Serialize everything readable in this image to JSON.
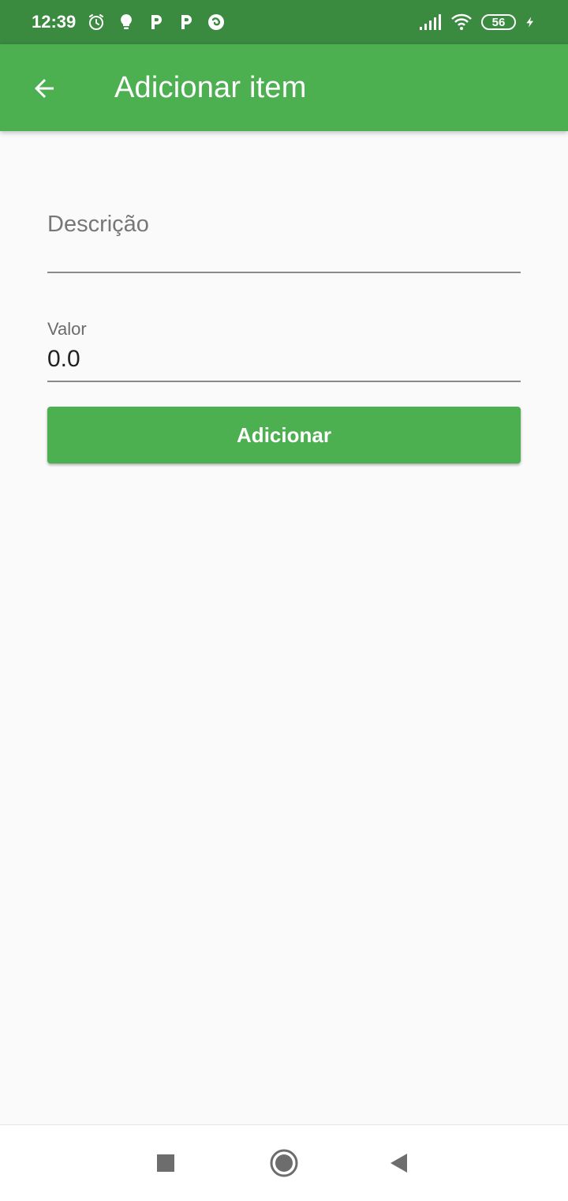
{
  "status_bar": {
    "time": "12:39",
    "battery_level": "56",
    "left_icons": [
      "alarm-icon",
      "lightbulb-icon",
      "p-app-icon",
      "p-app-icon",
      "swirl-app-icon"
    ],
    "right_icons": [
      "signal-icon",
      "wifi-icon",
      "battery-icon",
      "charging-icon"
    ]
  },
  "app_bar": {
    "title": "Adicionar item",
    "back_icon": "arrow-left-icon",
    "color": "#4caf50"
  },
  "form": {
    "descricao": {
      "placeholder": "Descrição",
      "value": ""
    },
    "valor": {
      "label": "Valor",
      "value": "0.0"
    },
    "submit_label": "Adicionar"
  },
  "nav_bar": {
    "items": [
      "recents-square-icon",
      "home-circle-icon",
      "back-triangle-icon"
    ]
  },
  "colors": {
    "primary": "#4caf50",
    "status_bar": "#3a8a40",
    "background": "#fafafa"
  }
}
